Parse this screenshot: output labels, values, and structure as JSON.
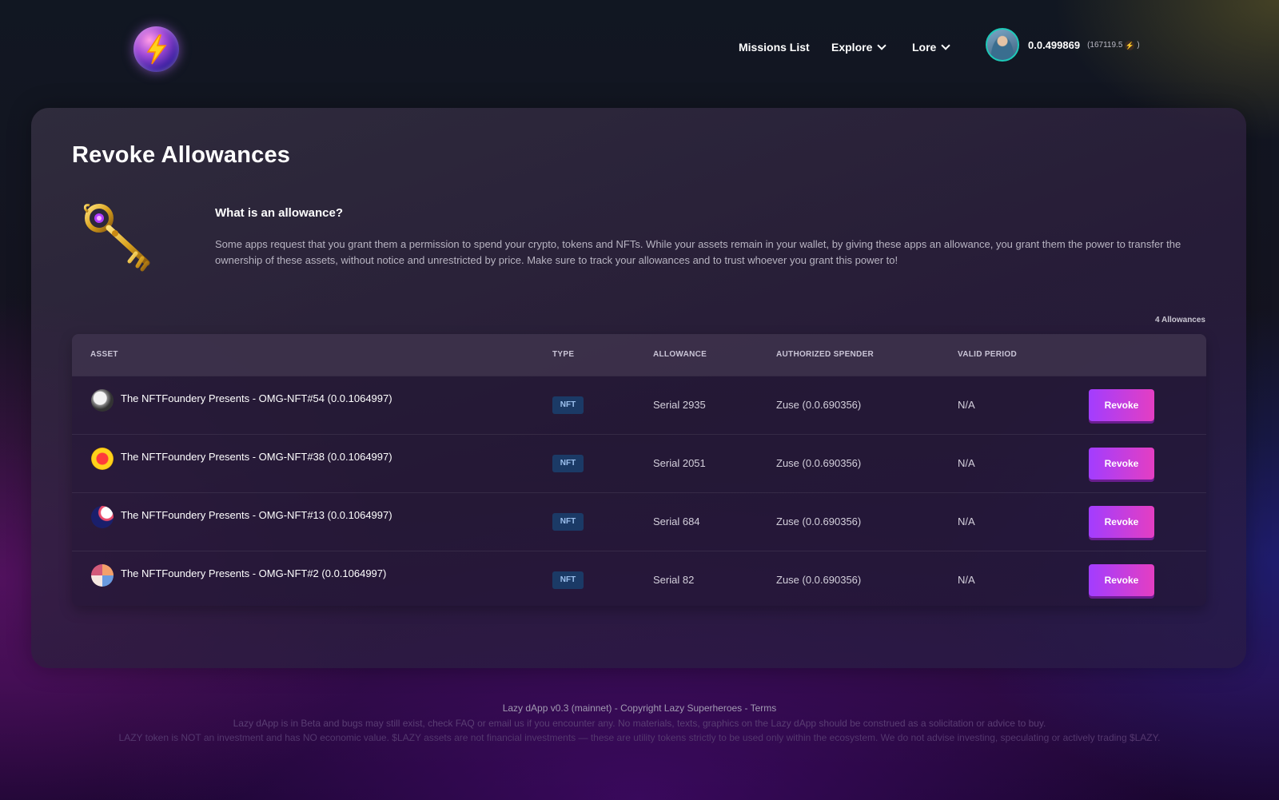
{
  "header": {
    "nav": [
      {
        "label": "Missions List",
        "has_dropdown": false
      },
      {
        "label": "Explore",
        "has_dropdown": true
      },
      {
        "label": "Lore",
        "has_dropdown": true
      }
    ],
    "account": {
      "id": "0.0.499869",
      "balance_open": "(167119.5",
      "balance_icon": "lightning-icon",
      "balance_close": ")"
    }
  },
  "page": {
    "title": "Revoke Allowances",
    "info_heading": "What is an allowance?",
    "info_text": "Some apps request that you grant them a permission to spend your crypto, tokens and NFTs. While your assets remain in your wallet, by giving these apps an allowance, you grant them the power to transfer the ownership of these assets, without notice and unrestricted by price. Make sure to track your allowances and to trust whoever you grant this power to!",
    "count_label": "4 Allowances"
  },
  "table": {
    "headers": [
      "ASSET",
      "TYPE",
      "ALLOWANCE",
      "AUTHORIZED SPENDER",
      "VALID PERIOD"
    ],
    "rows": [
      {
        "asset": "The NFTFoundery Presents - OMG-NFT#54 (0.0.1064997)",
        "type": "NFT",
        "allowance": "Serial 2935",
        "spender": "Zuse (0.0.690356)",
        "period": "N/A",
        "action": "Revoke"
      },
      {
        "asset": "The NFTFoundery Presents - OMG-NFT#38 (0.0.1064997)",
        "type": "NFT",
        "allowance": "Serial 2051",
        "spender": "Zuse (0.0.690356)",
        "period": "N/A",
        "action": "Revoke"
      },
      {
        "asset": "The NFTFoundery Presents - OMG-NFT#13 (0.0.1064997)",
        "type": "NFT",
        "allowance": "Serial 684",
        "spender": "Zuse (0.0.690356)",
        "period": "N/A",
        "action": "Revoke"
      },
      {
        "asset": "The NFTFoundery Presents - OMG-NFT#2 (0.0.1064997)",
        "type": "NFT",
        "allowance": "Serial 82",
        "spender": "Zuse (0.0.690356)",
        "period": "N/A",
        "action": "Revoke"
      }
    ]
  },
  "footer": {
    "line1": "Lazy dApp v0.3 (mainnet) - Copyright Lazy Superheroes - Terms",
    "line2": "Lazy dApp is in Beta and bugs may still exist, check FAQ or email us if you encounter any. No materials, texts, graphics on the Lazy dApp should be construed as a solicitation or advice to buy.",
    "line3": "LAZY token is NOT an investment and has NO economic value. $LAZY assets are not financial investments — these are utility tokens strictly to be used only within the ecosystem. We do not advise investing, speculating or actively trading $LAZY."
  },
  "colors": {
    "revoke_gradient_start": "#a23dff",
    "revoke_gradient_end": "#e43ec2",
    "badge_bg": "#1b3a66",
    "avatar_ring": "#1ec9b8"
  }
}
